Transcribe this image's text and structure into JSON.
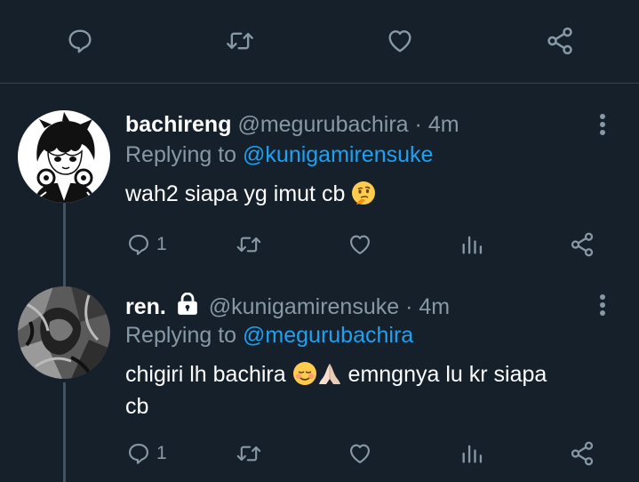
{
  "colors": {
    "background": "#15202b",
    "divider": "#38444d",
    "icon": "#8899a6",
    "link": "#1da1f2",
    "thread_line": "#3d5466"
  },
  "top_actions": {
    "icons": [
      "reply-icon",
      "retweet-icon",
      "like-icon",
      "share-icon"
    ]
  },
  "tweets": [
    {
      "display_name": "bachireng",
      "handle": "@megurubachira",
      "separator": "·",
      "time": "4m",
      "replying_prefix": "Replying to",
      "replying_to": "@kunigamirensuke",
      "text": "wah2 siapa yg imut cb",
      "text_emoji": "thinking-face-emoji",
      "protected": false,
      "reply_count": "1",
      "icons": [
        "reply-icon",
        "retweet-icon",
        "like-icon",
        "analytics-icon",
        "share-icon"
      ]
    },
    {
      "display_name": "ren.",
      "handle": "@kunigamirensuke",
      "separator": "·",
      "time": "4m",
      "replying_prefix": "Replying to",
      "replying_to": "@megurubachira",
      "text_part1": "chigiri lh bachira",
      "text_emojis": [
        "smiling-face-emoji",
        "folded-hands-emoji"
      ],
      "text_part2": "emngnya lu kr siapa",
      "text_line2": "cb",
      "protected": true,
      "protected_icon": "lock-icon",
      "reply_count": "1",
      "icons": [
        "reply-icon",
        "retweet-icon",
        "like-icon",
        "analytics-icon",
        "share-icon"
      ]
    }
  ]
}
